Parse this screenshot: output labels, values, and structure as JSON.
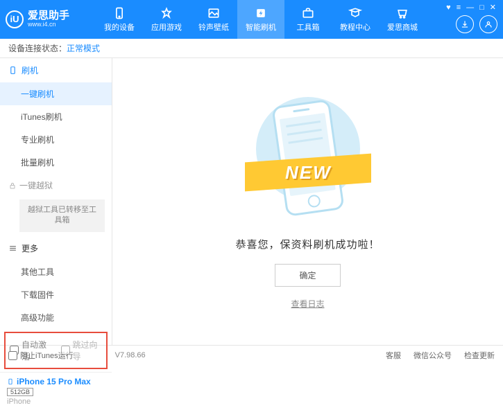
{
  "header": {
    "logo_text": "爱思助手",
    "logo_sub": "www.i4.cn",
    "logo_letter": "iU",
    "nav": [
      {
        "label": "我的设备"
      },
      {
        "label": "应用游戏"
      },
      {
        "label": "铃声壁纸"
      },
      {
        "label": "智能刷机"
      },
      {
        "label": "工具箱"
      },
      {
        "label": "教程中心"
      },
      {
        "label": "爱思商城"
      }
    ]
  },
  "status": {
    "prefix": "设备连接状态：",
    "value": "正常模式"
  },
  "sidebar": {
    "flash_header": "刷机",
    "items": {
      "one_key": "一键刷机",
      "itunes": "iTunes刷机",
      "pro": "专业刷机",
      "batch": "批量刷机"
    },
    "jailbreak_header": "一键越狱",
    "jailbreak_note": "越狱工具已转移至工具箱",
    "more_header": "更多",
    "more_items": {
      "other_tools": "其他工具",
      "download_fw": "下载固件",
      "advanced": "高级功能"
    },
    "options": {
      "auto_activate": "自动激活",
      "skip_guide": "跳过向导"
    },
    "device": {
      "name": "iPhone 15 Pro Max",
      "storage": "512GB",
      "type": "iPhone"
    }
  },
  "content": {
    "new_label": "NEW",
    "success_text": "恭喜您，保资料刷机成功啦！",
    "ok_button": "确定",
    "view_log": "查看日志"
  },
  "footer": {
    "block_itunes": "阻止iTunes运行",
    "version": "V7.98.66",
    "links": {
      "service": "客服",
      "wechat": "微信公众号",
      "update": "检查更新"
    }
  }
}
